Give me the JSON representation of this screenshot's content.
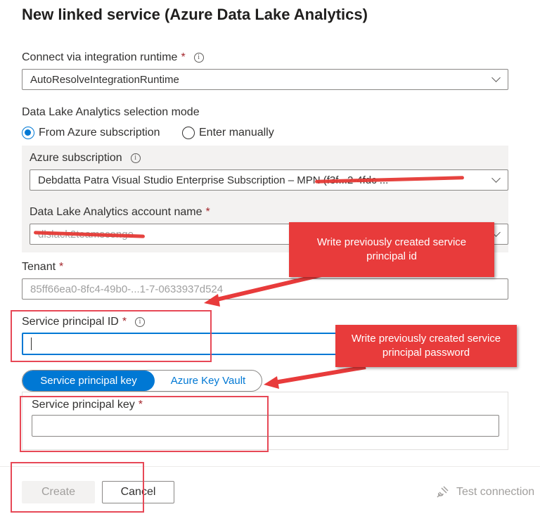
{
  "title": "New linked service (Azure Data Lake Analytics)",
  "runtime": {
    "label": "Connect via integration runtime",
    "required": "*",
    "value": "AutoResolveIntegrationRuntime"
  },
  "mode": {
    "label": "Data Lake Analytics selection mode",
    "options": [
      "From Azure subscription",
      "Enter manually"
    ],
    "selected": "From Azure subscription"
  },
  "subscription": {
    "label": "Azure subscription",
    "value": "Debdatta Patra Visual Studio Enterprise Subscription – MPN (f3f...2-4fdc ..."
  },
  "account": {
    "label": "Data Lake Analytics account name",
    "required": "*",
    "value": "dlslack2teamscongo"
  },
  "tenant": {
    "label": "Tenant",
    "required": "*",
    "value": "85ff66ea0-8fc4-49b0-...1-7-0633937d524"
  },
  "sp_id": {
    "label": "Service principal ID",
    "required": "*",
    "value": ""
  },
  "auth_toggle": {
    "options": [
      "Service principal key",
      "Azure Key Vault"
    ],
    "selected": "Service principal key"
  },
  "sp_key": {
    "label": "Service principal key",
    "required": "*",
    "value": ""
  },
  "callouts": {
    "id_note": "Write previously created service principal id",
    "password_note": "Write previously created service principal password"
  },
  "footer": {
    "create": "Create",
    "cancel": "Cancel",
    "test": "Test connection"
  },
  "colors": {
    "accent": "#0078d4",
    "annotation": "#e83b3b"
  }
}
